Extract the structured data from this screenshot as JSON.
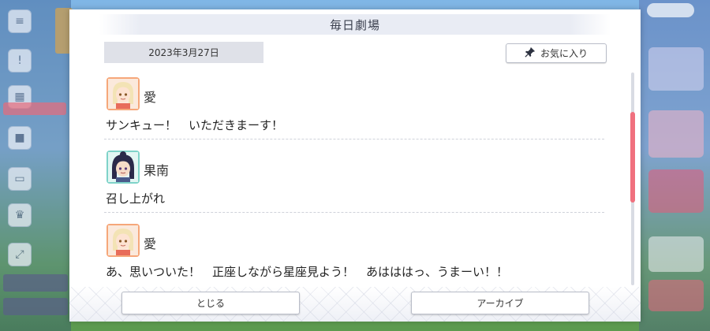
{
  "dialog": {
    "title": "毎日劇場",
    "date": "2023年3月27日",
    "favorite_label": "お気に入り"
  },
  "entries": [
    {
      "speaker": "愛",
      "line": "サンキュー！　いただきまーす！",
      "avatar": "ai-avatar-icon"
    },
    {
      "speaker": "果南",
      "line": "召し上がれ",
      "avatar": "kanan-avatar-icon"
    },
    {
      "speaker": "愛",
      "line": "あ、思いついた！　正座しながら星座見よう！　あはははっ、うまーい！！",
      "avatar": "ai-avatar-icon"
    }
  ],
  "footer": {
    "close_label": "とじる",
    "archive_label": "アーカイブ"
  },
  "colors": {
    "accent": "#f0707e",
    "date_bg": "#dfe1e8",
    "ai_avatar_bg": "#f6a77a",
    "kanan_avatar_bg": "#7fd3c9"
  }
}
